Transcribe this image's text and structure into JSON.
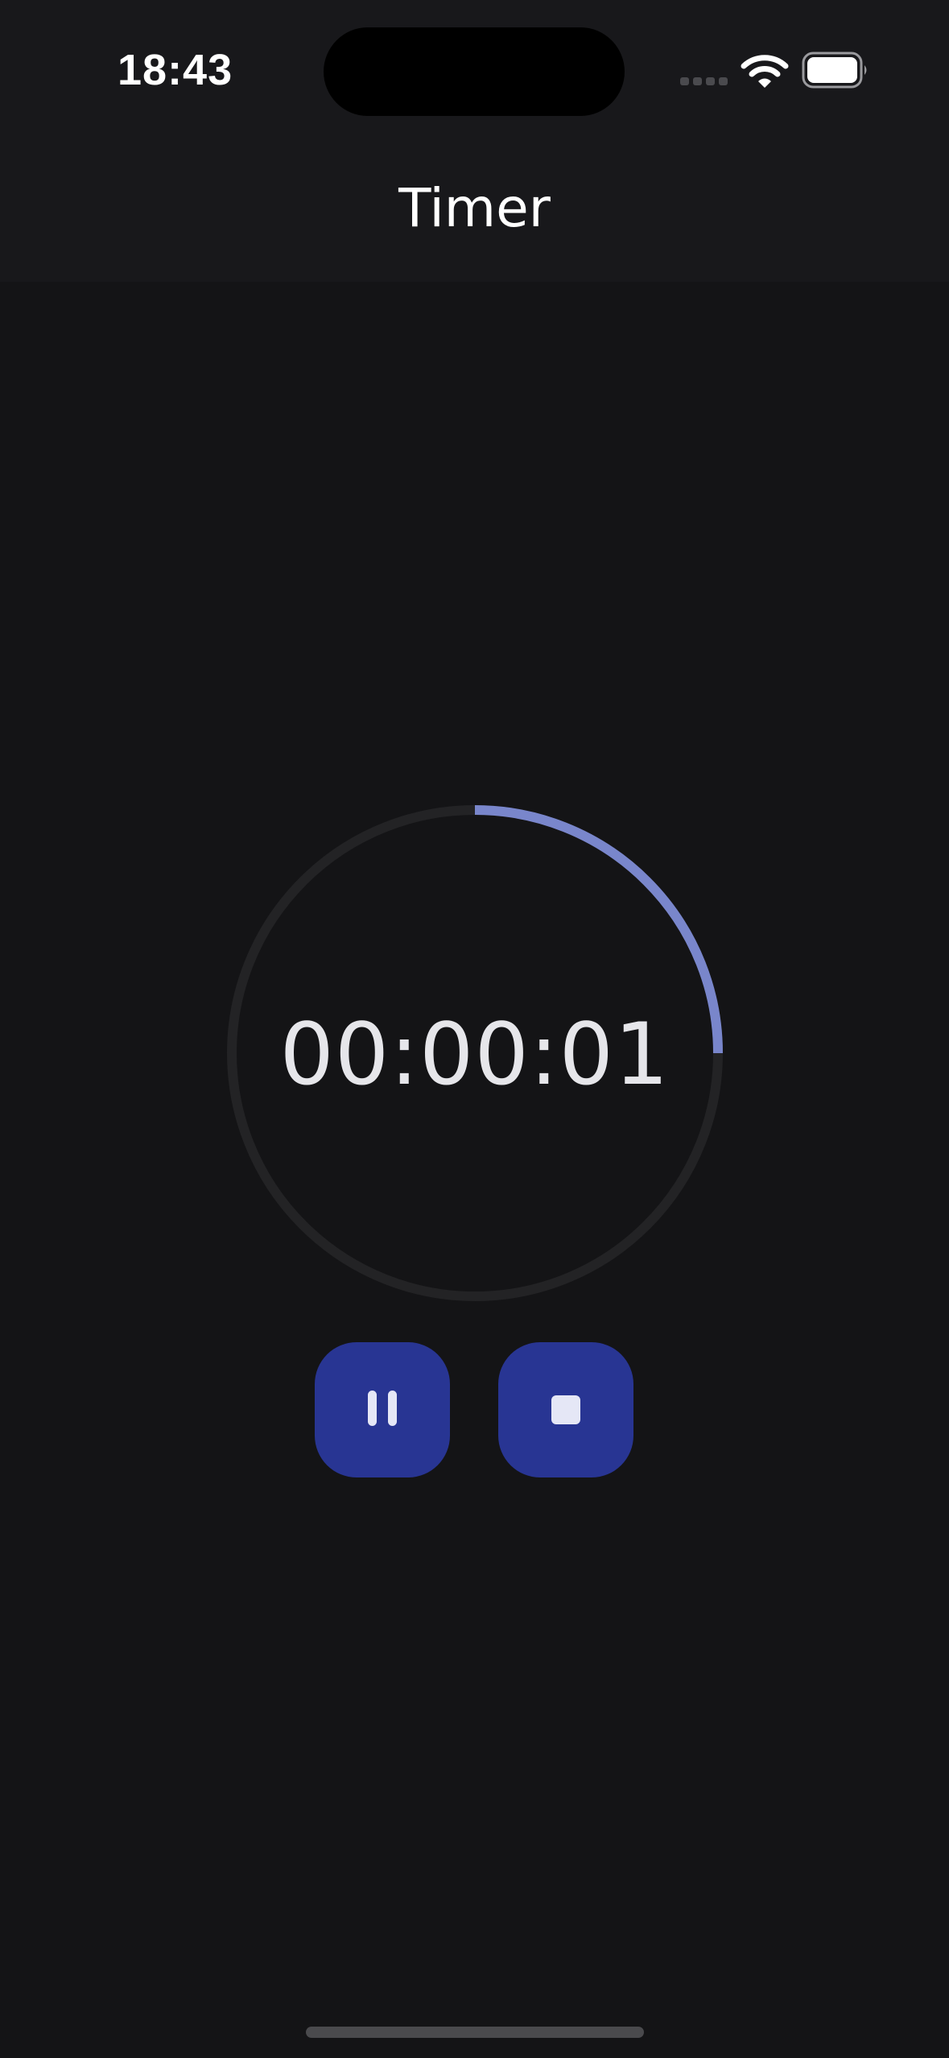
{
  "status_bar": {
    "time": "18:43",
    "icons": [
      "cellular-signal-icon",
      "wifi-icon",
      "battery-icon"
    ]
  },
  "header": {
    "title": "Timer"
  },
  "timer": {
    "display": "00:00:01",
    "progress_fraction": 0.25
  },
  "controls": {
    "pause_icon": "pause-icon",
    "stop_icon": "stop-icon"
  },
  "colors": {
    "background": "#141416",
    "header_background": "#18181b",
    "ring_track": "#232325",
    "ring_progress": "#7986cb",
    "button": "#283593",
    "button_icon": "#e5e7f6"
  }
}
